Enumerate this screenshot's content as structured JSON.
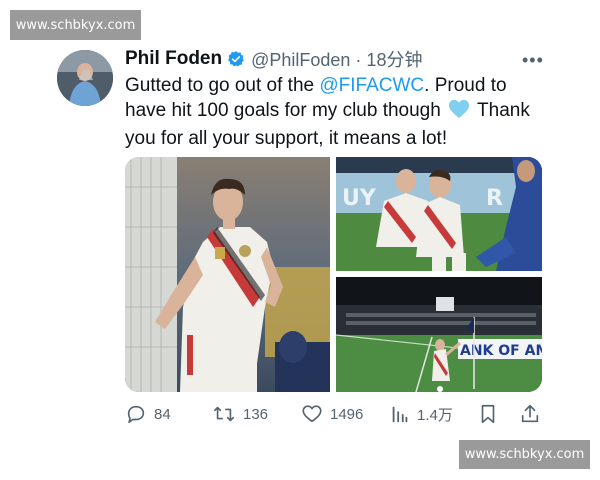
{
  "watermarks": {
    "top": "www.schbkyx.com",
    "bottom": "www.schbkyx.com"
  },
  "tweet": {
    "display_name": "Phil Foden",
    "handle_time": "@PhilFoden · 18分钟",
    "more_label": "•••",
    "text_before": "Gutted to go out of the ",
    "mention": "@FIFACWC",
    "text_after_mention": ". Proud to have hit 100 goals for my club though ",
    "text_end": " Thank you for all your support, it means a lot!",
    "emoji": "light-blue-heart",
    "stadium_board_text": "ANK OF AMERI",
    "colors": {
      "mention": "#1d9bf0",
      "verified": "#1d9bf0",
      "heart": "#7fd0f0",
      "muted": "#536471"
    }
  },
  "actions": {
    "replies": "84",
    "reposts": "136",
    "likes": "1496",
    "views": "1.4万",
    "icons": [
      "reply-icon",
      "repost-icon",
      "like-icon",
      "views-icon",
      "bookmark-icon",
      "share-icon"
    ]
  }
}
